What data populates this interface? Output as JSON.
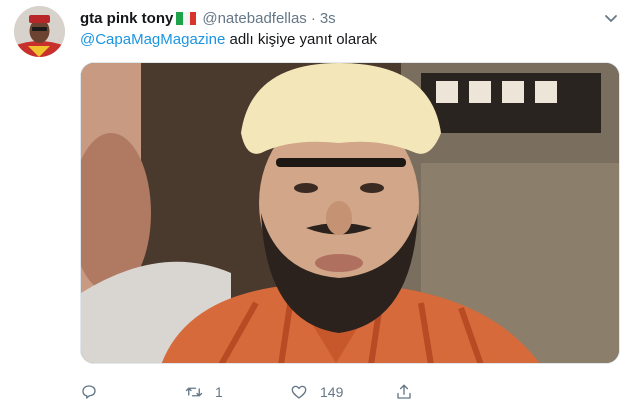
{
  "tweet": {
    "display_name": "gta pink tony",
    "handle": "@natebadfellas",
    "separator": "·",
    "time": "3s",
    "reply_mention": "@CapaMagMagazine",
    "reply_suffix": " adlı kişiye yanıt olarak"
  },
  "actions": {
    "reply_icon": "reply-icon",
    "retweet_icon": "retweet-icon",
    "retweet_count": "1",
    "like_icon": "heart-icon",
    "like_count": "149",
    "share_icon": "share-icon"
  },
  "colors": {
    "link": "#1b95e0",
    "muted": "#657786",
    "text": "#14171a",
    "border": "#e1e8ed"
  }
}
